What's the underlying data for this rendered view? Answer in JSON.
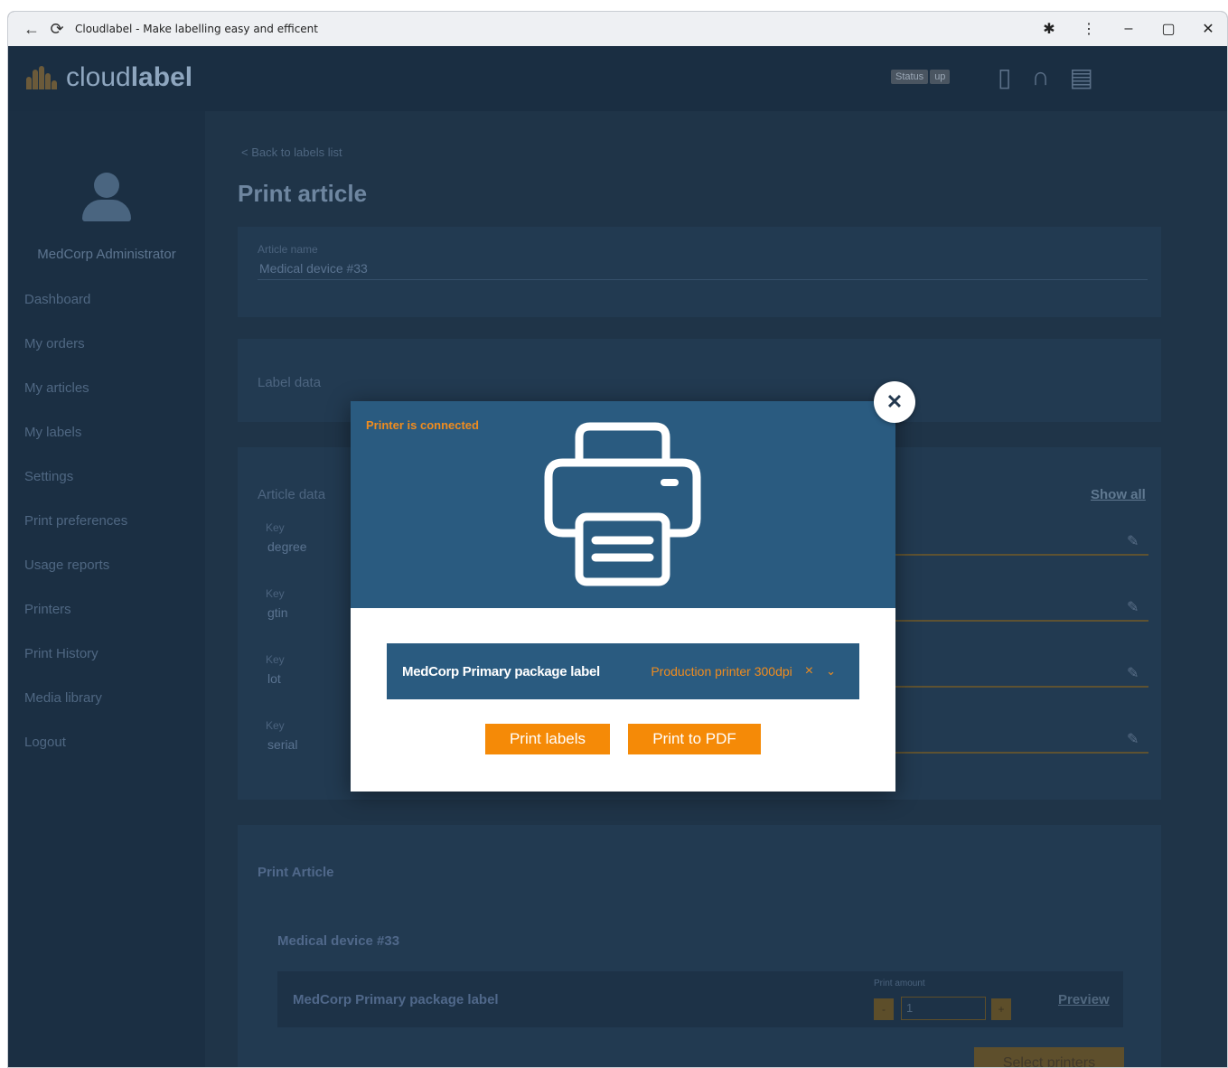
{
  "browser": {
    "title": "Cloudlabel - Make labelling easy and efficent",
    "back_icon": "back-arrow-icon",
    "reload_icon": "reload-icon"
  },
  "header": {
    "logo_light": "cloud",
    "logo_bold": "label",
    "status_label": "Status",
    "status_value": "up"
  },
  "sidebar": {
    "user_name": "MedCorp Administrator",
    "items": [
      {
        "label": "Dashboard"
      },
      {
        "label": "My orders"
      },
      {
        "label": "My articles"
      },
      {
        "label": "My labels"
      },
      {
        "label": "Settings"
      },
      {
        "label": "Print preferences"
      },
      {
        "label": "Usage reports"
      },
      {
        "label": "Printers"
      },
      {
        "label": "Print History"
      },
      {
        "label": "Media library"
      },
      {
        "label": "Logout"
      }
    ]
  },
  "main": {
    "back_link": "< Back to labels list",
    "title": "Print article",
    "article_name_label": "Article name",
    "article_name_value": "Medical device #33",
    "label_data_title": "Label data",
    "article_data_title": "Article data",
    "show_all": "Show all",
    "article_fields": [
      {
        "key_label": "Key",
        "key_value": "degree"
      },
      {
        "key_label": "Key",
        "key_value": "gtin"
      },
      {
        "key_label": "Key",
        "key_value": "lot"
      },
      {
        "key_label": "Key",
        "key_value": "serial"
      }
    ],
    "print_article_title": "Print Article",
    "print_article_name": "Medical device #33",
    "print_row_label": "MedCorp Primary package label",
    "print_amount_label": "Print amount",
    "print_amount_value": "1",
    "stepper_minus": "-",
    "stepper_plus": "+",
    "preview": "Preview",
    "select_printers": "Select printers"
  },
  "modal": {
    "status": "Printer is connected",
    "label_name": "MedCorp Primary package label",
    "printer_name": "Production printer 300dpi",
    "clear_icon": "×",
    "caret_icon": "⌄",
    "close_icon": "✕",
    "print_labels": "Print labels",
    "print_pdf": "Print to PDF",
    "accent_color": "#f58a07",
    "header_color": "#2a5b80"
  }
}
